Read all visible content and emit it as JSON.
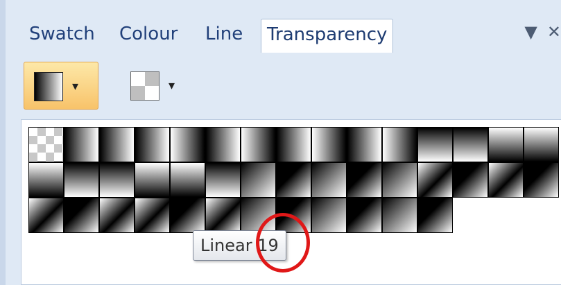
{
  "tabs": [
    {
      "label": "Swatch",
      "active": false
    },
    {
      "label": "Colour",
      "active": false
    },
    {
      "label": "Line",
      "active": false
    },
    {
      "label": "Transparency",
      "active": true
    }
  ],
  "tab_controls": {
    "menu_glyph": "▼",
    "close_glyph": "✕"
  },
  "toolbar": {
    "buttons": [
      {
        "icon": "gradient-icon",
        "dropdown_glyph": "▾",
        "selected": true
      },
      {
        "icon": "checkerboard-icon",
        "dropdown_glyph": "▾",
        "selected": false
      }
    ]
  },
  "gallery": {
    "cells": [
      {
        "kind": "none"
      },
      {
        "kind": "lin-r"
      },
      {
        "kind": "lin-r"
      },
      {
        "kind": "lin-r"
      },
      {
        "kind": "lin-l"
      },
      {
        "kind": "lin-r"
      },
      {
        "kind": "lin-l"
      },
      {
        "kind": "lin-r"
      },
      {
        "kind": "lin-l"
      },
      {
        "kind": "lin-r"
      },
      {
        "kind": "lin-l"
      },
      {
        "kind": "lin-d"
      },
      {
        "kind": "lin-d"
      },
      {
        "kind": "lin-u"
      },
      {
        "kind": "lin-u"
      },
      {
        "kind": "lin-u"
      },
      {
        "kind": "lin-d"
      },
      {
        "kind": "lin-d"
      },
      {
        "kind": "lin-u"
      },
      {
        "kind": "lin-u"
      },
      {
        "kind": "lin-d"
      },
      {
        "kind": "diag-a"
      },
      {
        "kind": "diag-b"
      },
      {
        "kind": "diag-a"
      },
      {
        "kind": "diag-b"
      },
      {
        "kind": "diag-a"
      },
      {
        "kind": "diag-c"
      },
      {
        "kind": "diag-b"
      },
      {
        "kind": "diag-c"
      },
      {
        "kind": "diag-b"
      },
      {
        "kind": "diag-c"
      },
      {
        "kind": "diag-b"
      },
      {
        "kind": "diag-c"
      },
      {
        "kind": "diag-c"
      },
      {
        "kind": "diag-b"
      },
      {
        "kind": "diag-c"
      },
      {
        "kind": "diag-a"
      },
      {
        "kind": "diag-b"
      },
      {
        "kind": "diag-a"
      },
      {
        "kind": "diag-b"
      },
      {
        "kind": "diag-a"
      },
      {
        "kind": "diag-b"
      }
    ]
  },
  "tooltip": {
    "text": "Linear 19"
  }
}
